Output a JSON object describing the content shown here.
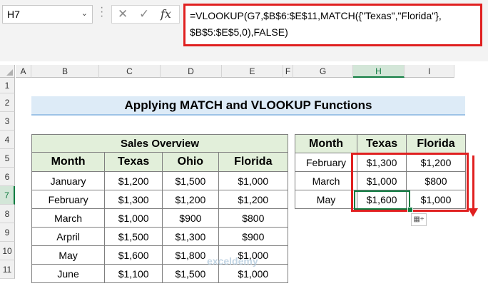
{
  "name_box": "H7",
  "formula_text": "=VLOOKUP(G7,$B$6:$E$11,MATCH({\"Texas\",\"Florida\"},\n$B$5:$E$5,0),FALSE)",
  "columns": [
    "A",
    "B",
    "C",
    "D",
    "E",
    "F",
    "G",
    "H",
    "I"
  ],
  "rows": [
    "1",
    "2",
    "3",
    "4",
    "5",
    "6",
    "7",
    "8",
    "9",
    "10",
    "11"
  ],
  "title": "Applying MATCH and VLOOKUP Functions",
  "sales": {
    "caption": "Sales Overview",
    "headers": [
      "Month",
      "Texas",
      "Ohio",
      "Florida"
    ],
    "rows": [
      [
        "January",
        "$1,200",
        "$1,500",
        "$1,000"
      ],
      [
        "February",
        "$1,300",
        "$1,200",
        "$1,200"
      ],
      [
        "March",
        "$1,000",
        "$900",
        "$800"
      ],
      [
        "Arpril",
        "$1,500",
        "$1,300",
        "$900"
      ],
      [
        "May",
        "$1,600",
        "$1,800",
        "$1,000"
      ],
      [
        "June",
        "$1,100",
        "$1,500",
        "$1,000"
      ]
    ]
  },
  "result": {
    "headers": [
      "Month",
      "Texas",
      "Florida"
    ],
    "rows": [
      [
        "February",
        "$1,300",
        "$1,200"
      ],
      [
        "March",
        "$1,000",
        "$800"
      ],
      [
        "May",
        "$1,600",
        "$1,000"
      ]
    ]
  },
  "watermark": "exceldemy",
  "colors": {
    "accent_red": "#e02020",
    "excel_green": "#107c41",
    "table_header": "#e2efda",
    "title_bg": "#ddebf7"
  }
}
